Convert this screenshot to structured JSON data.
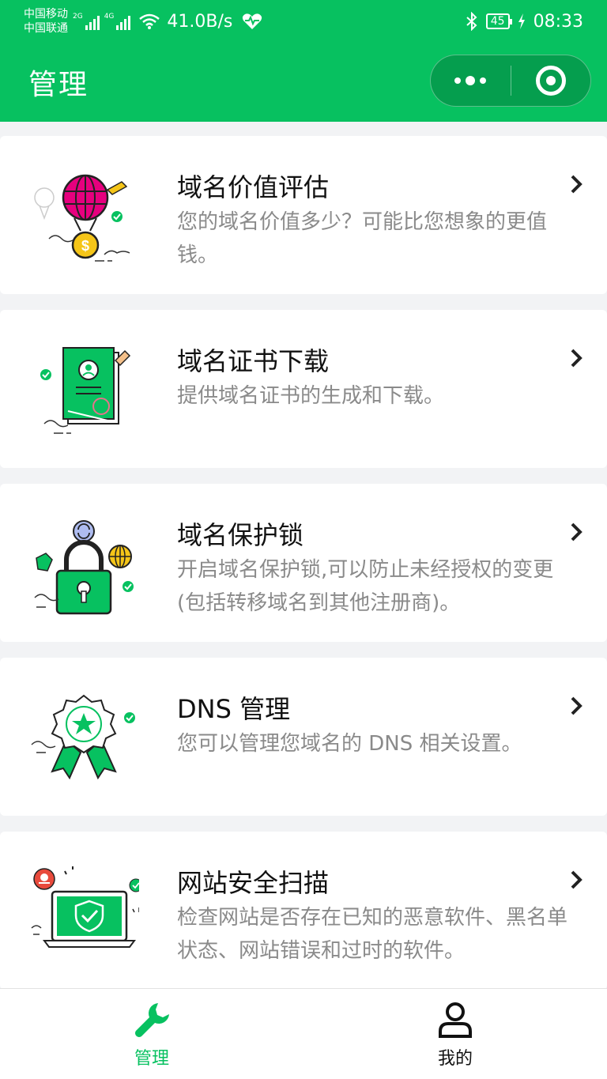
{
  "status_bar": {
    "carrier_1": "中国移动",
    "carrier_2": "中国联通",
    "net_1": "2G",
    "net_2": "4G",
    "speed": "41.0B/s",
    "battery": "45",
    "time": "08:33"
  },
  "nav": {
    "title": "管理"
  },
  "items": [
    {
      "title": "域名价值评估",
      "desc": "您的域名价值多少？可能比您想象的更值钱。"
    },
    {
      "title": "域名证书下载",
      "desc": "提供域名证书的生成和下载。"
    },
    {
      "title": "域名保护锁",
      "desc": "开启域名保护锁,可以防止未经授权的变更(包括转移域名到其他注册商)。"
    },
    {
      "title": "DNS 管理",
      "desc": "您可以管理您域名的 DNS 相关设置。"
    },
    {
      "title": "网站安全扫描",
      "desc": "检查网站是否存在已知的恶意软件、黑名单状态、网站错误和过时的软件。"
    }
  ],
  "tabbar": {
    "tabs": [
      {
        "label": "管理",
        "active": true
      },
      {
        "label": "我的",
        "active": false
      }
    ]
  },
  "colors": {
    "brand": "#07c160",
    "desc_text": "#8a8a8a"
  }
}
